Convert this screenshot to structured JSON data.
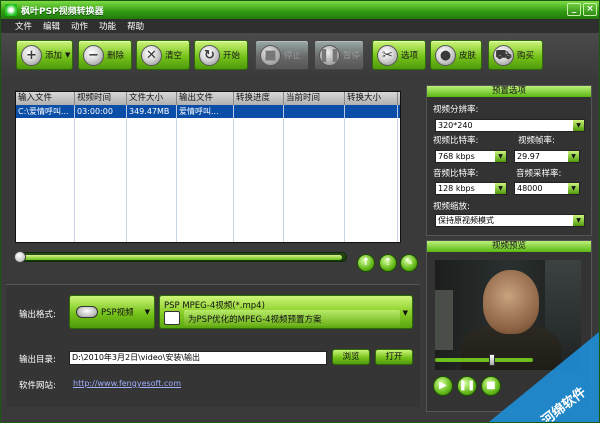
{
  "window": {
    "title": "枫叶PSP视频转换器"
  },
  "menu": [
    "文件",
    "编辑",
    "动作",
    "功能",
    "帮助"
  ],
  "toolbar": [
    {
      "name": "add-button",
      "label": "添加",
      "icon": "plus-icon",
      "glyph": "+",
      "dropdown": true,
      "enabled": true
    },
    {
      "name": "delete-button",
      "label": "删除",
      "icon": "minus-icon",
      "glyph": "−",
      "enabled": true
    },
    {
      "name": "clear-button",
      "label": "清空",
      "icon": "clear-icon",
      "glyph": "✕",
      "enabled": true
    },
    {
      "name": "start-button",
      "label": "开始",
      "icon": "refresh-icon",
      "glyph": "↻",
      "enabled": true
    },
    {
      "name": "stop-button",
      "label": "停止",
      "icon": "stop-icon",
      "glyph": "■",
      "enabled": false
    },
    {
      "name": "pause-button",
      "label": "暂停",
      "icon": "pause-icon",
      "glyph": "❚❚",
      "enabled": false
    },
    {
      "name": "options-button",
      "label": "选项",
      "icon": "wrench-icon",
      "glyph": "✂",
      "enabled": true
    },
    {
      "name": "skin-button",
      "label": "皮肤",
      "icon": "apple-icon",
      "glyph": "●",
      "enabled": true
    },
    {
      "name": "buy-button",
      "label": "购买",
      "icon": "cart-icon",
      "glyph": "⛟",
      "enabled": true
    }
  ],
  "file_list": {
    "columns": [
      "输入文件",
      "视频时间",
      "文件大小",
      "输出文件",
      "转换进度",
      "当前时间",
      "转换大小"
    ],
    "rows": [
      [
        "C:\\爱情呼叫...",
        "03:00:00",
        "349.47MB",
        "爱情呼叫...",
        "",
        "",
        ""
      ]
    ]
  },
  "output": {
    "format_label": "输出格式:",
    "format_button": "PSP视频",
    "format_name": "PSP MPEG-4视频(*.mp4)",
    "format_desc": "为PSP优化的MPEG-4视频预置方案",
    "dir_label": "输出目录:",
    "dir_value": "D:\\2010年3月2日\\video\\安装\\输出",
    "browse_label": "浏览",
    "open_label": "打开",
    "site_label": "软件网站:",
    "site_url": "http://www.fengyesoft.com"
  },
  "presets": {
    "header": "预置选项",
    "resolution_label": "视频分辨率:",
    "resolution_value": "320*240",
    "vbitrate_label": "视频比特率:",
    "vbitrate_value": "768 kbps",
    "fps_label": "视频帧率:",
    "fps_value": "29.97",
    "abitrate_label": "音频比特率:",
    "abitrate_value": "128 kbps",
    "asample_label": "音频采样率:",
    "asample_value": "48000",
    "zoom_label": "视频缩放:",
    "zoom_value": "保持原视频模式"
  },
  "preview": {
    "header": "视频预览"
  },
  "watermark": "河绵软件",
  "colors": {
    "accent": "#6cbf1c",
    "title_bar": "#2f9a12",
    "selection": "#0a4ea8"
  }
}
